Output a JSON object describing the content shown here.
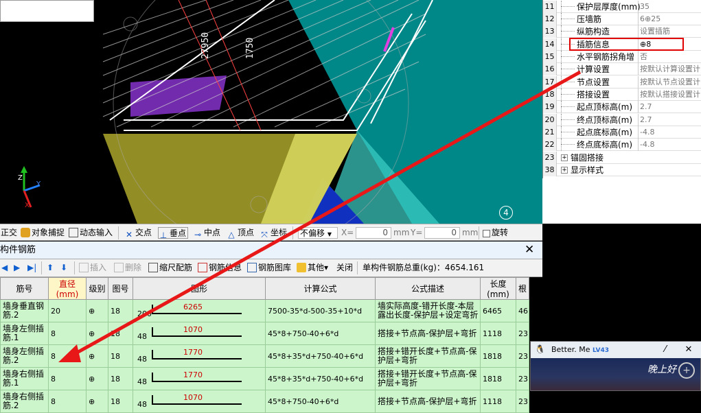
{
  "viewport": {
    "dimension_a": "27950",
    "dimension_b": "1750",
    "axis_marker": "4",
    "axis_labels": {
      "z": "Z",
      "y": "Y",
      "x": "X"
    }
  },
  "props": {
    "rows": [
      {
        "num": "11",
        "name": "保护层厚度(mm)",
        "value": "35"
      },
      {
        "num": "12",
        "name": "压墙筋",
        "value": "6⊕25"
      },
      {
        "num": "13",
        "name": "纵筋构造",
        "value": "设置插筋"
      },
      {
        "num": "14",
        "name": "插筋信息",
        "value": "⊕8"
      },
      {
        "num": "15",
        "name": "水平钢筋拐角增",
        "value": "否"
      },
      {
        "num": "16",
        "name": "计算设置",
        "value": "按默认计算设置计"
      },
      {
        "num": "17",
        "name": "节点设置",
        "value": "按默认节点设置计"
      },
      {
        "num": "18",
        "name": "搭接设置",
        "value": "按默认搭接设置计"
      },
      {
        "num": "19",
        "name": "起点顶标高(m)",
        "value": "2.7"
      },
      {
        "num": "20",
        "name": "终点顶标高(m)",
        "value": "2.7"
      },
      {
        "num": "21",
        "name": "起点底标高(m)",
        "value": "-4.8"
      },
      {
        "num": "22",
        "name": "终点底标高(m)",
        "value": "-4.8"
      },
      {
        "num": "23",
        "name": "锚固搭接",
        "value": ""
      },
      {
        "num": "38",
        "name": "显示样式",
        "value": ""
      }
    ]
  },
  "snapbar": {
    "ortho": "正交",
    "object_snap": "对象捕捉",
    "dynamic_input": "动态输入",
    "intersection": "交点",
    "perpendicular": "垂点",
    "midpoint": "中点",
    "vertex": "顶点",
    "coordinate": "坐标",
    "offset_select": "不偏移",
    "x_label": "X=",
    "x_value": "0",
    "y_label": "Y=",
    "y_value": "0",
    "unit": "mm",
    "rotate": "旋转"
  },
  "rebar": {
    "panel_title": "构件钢筋",
    "tools": {
      "insert": "插入",
      "delete": "删除",
      "scale_rebar": "缩尺配筋",
      "rebar_info": "钢筋信息",
      "rebar_library": "钢筋图库",
      "other": "其他",
      "close": "关闭",
      "total_weight": "单构件钢筋总重(kg)：4654.161"
    },
    "columns": [
      "筋号",
      "直径(mm)",
      "级别",
      "图号",
      "图形",
      "计算公式",
      "公式描述",
      "长度(mm)",
      "根"
    ],
    "rows": [
      {
        "name": "墙身垂直钢筋.2",
        "dia": "20",
        "grade": "⊕",
        "fig": "18",
        "lead": "200",
        "len_label": "6265",
        "formula": "7500-35*d-500-35+10*d",
        "desc": "墙实际高度-错开长度-本层露出长度-保护层+设定弯折",
        "length": "6465",
        "count": "46"
      },
      {
        "name": "墙身左侧插筋.1",
        "dia": "8",
        "grade": "⊕",
        "fig": "18",
        "lead": "48",
        "len_label": "1070",
        "formula": "45*8+750-40+6*d",
        "desc": "搭接+节点高-保护层+弯折",
        "length": "1118",
        "count": "23"
      },
      {
        "name": "墙身左侧插筋.2",
        "dia": "8",
        "grade": "⊕",
        "fig": "18",
        "lead": "48",
        "len_label": "1770",
        "formula": "45*8+35*d+750-40+6*d",
        "desc": "搭接+错开长度+节点高-保护层+弯折",
        "length": "1818",
        "count": "23"
      },
      {
        "name": "墙身右侧插筋.1",
        "dia": "8",
        "grade": "⊕",
        "fig": "18",
        "lead": "48",
        "len_label": "1770",
        "formula": "45*8+35*d+750-40+6*d",
        "desc": "搭接+错开长度+节点高-保护层+弯折",
        "length": "1818",
        "count": "23"
      },
      {
        "name": "墙身右侧插筋.2",
        "dia": "8",
        "grade": "⊕",
        "fig": "18",
        "lead": "48",
        "len_label": "1070",
        "formula": "45*8+750-40+6*d",
        "desc": "搭接+节点高-保护层+弯折",
        "length": "1118",
        "count": "23"
      }
    ]
  },
  "popup": {
    "user": "Better. Me",
    "level": "LV43",
    "signature": "晚上好"
  }
}
